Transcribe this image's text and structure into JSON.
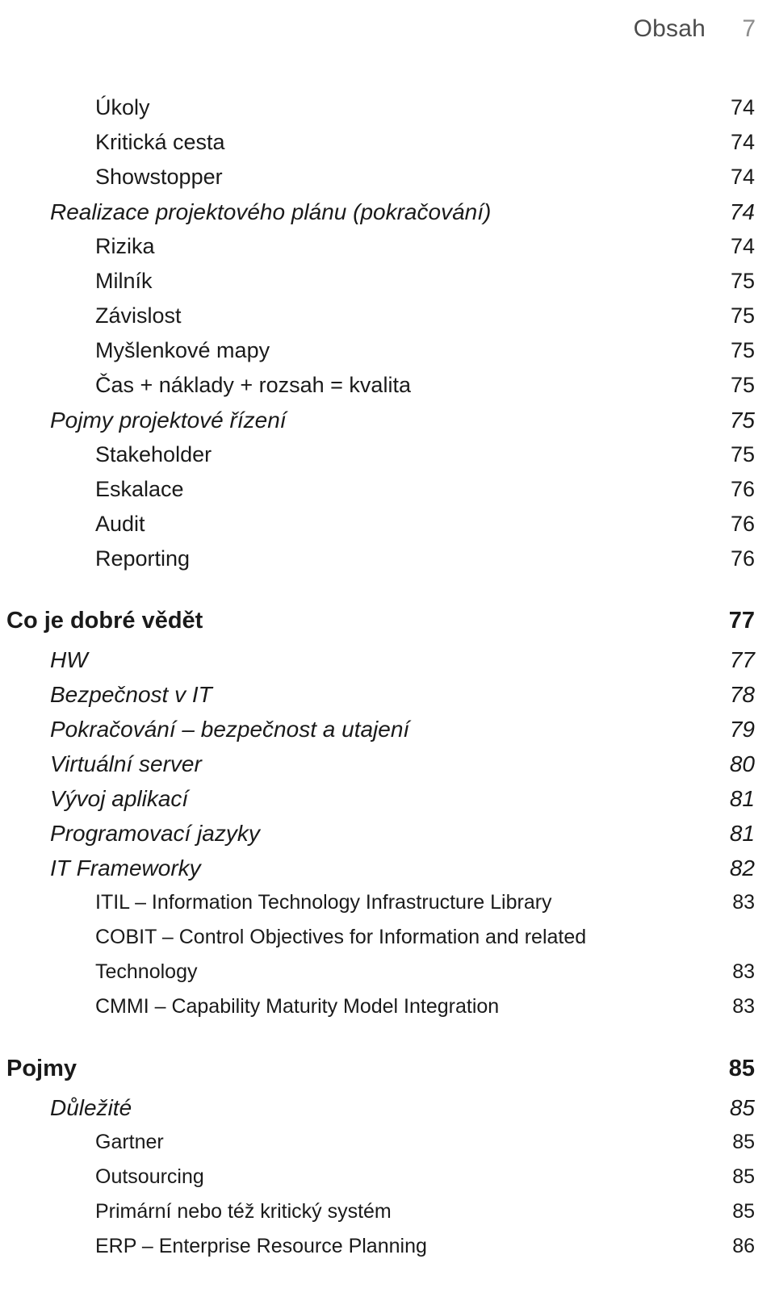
{
  "running_head": {
    "title": "Obsah",
    "folio": "7"
  },
  "toc": {
    "entries": [
      {
        "label": "Úkoly",
        "page": "74",
        "level": 2,
        "style": "plain"
      },
      {
        "label": "Kritická cesta",
        "page": "74",
        "level": 2,
        "style": "plain"
      },
      {
        "label": "Showstopper",
        "page": "74",
        "level": 2,
        "style": "plain"
      },
      {
        "label": "Realizace projektového plánu (pokračování)",
        "page": "74",
        "level": 1,
        "style": "italic"
      },
      {
        "label": "Rizika",
        "page": "74",
        "level": 2,
        "style": "plain"
      },
      {
        "label": "Milník",
        "page": "75",
        "level": 2,
        "style": "plain"
      },
      {
        "label": "Závislost",
        "page": "75",
        "level": 2,
        "style": "plain"
      },
      {
        "label": "Myšlenkové mapy",
        "page": "75",
        "level": 2,
        "style": "plain"
      },
      {
        "label": "Čas + náklady + rozsah = kvalita",
        "page": "75",
        "level": 2,
        "style": "plain"
      },
      {
        "label": "Pojmy projektové řízení",
        "page": "75",
        "level": 1,
        "style": "italic"
      },
      {
        "label": "Stakeholder",
        "page": "75",
        "level": 2,
        "style": "plain"
      },
      {
        "label": "Eskalace",
        "page": "76",
        "level": 2,
        "style": "plain"
      },
      {
        "label": "Audit",
        "page": "76",
        "level": 2,
        "style": "plain"
      },
      {
        "label": "Reporting",
        "page": "76",
        "level": 2,
        "style": "plain"
      },
      {
        "label": "Co je dobré vědět",
        "page": "77",
        "level": 0,
        "style": "bold"
      },
      {
        "label": "HW",
        "page": "77",
        "level": 1,
        "style": "italic"
      },
      {
        "label": "Bezpečnost v IT",
        "page": "78",
        "level": 1,
        "style": "italic"
      },
      {
        "label": "Pokračování – bezpečnost a utajení",
        "page": "79",
        "level": 1,
        "style": "italic"
      },
      {
        "label": "Virtuální server",
        "page": "80",
        "level": 1,
        "style": "italic"
      },
      {
        "label": "Vývoj aplikací",
        "page": "81",
        "level": 1,
        "style": "italic"
      },
      {
        "label": "Programovací jazyky",
        "page": "81",
        "level": 1,
        "style": "italic"
      },
      {
        "label": "IT Frameworky",
        "page": "82",
        "level": 1,
        "style": "italic"
      },
      {
        "label": "ITIL – Information Technology Infrastructure Library",
        "page": "83",
        "level": 3,
        "style": "plain"
      },
      {
        "label": "COBIT – Control Objectives for Information and related",
        "page": "",
        "level": 3,
        "style": "plain"
      },
      {
        "label": "Technology",
        "page": "83",
        "level": 3,
        "style": "plain"
      },
      {
        "label": "CMMI – Capability Maturity Model Integration",
        "page": "83",
        "level": 3,
        "style": "plain"
      },
      {
        "label": "Pojmy",
        "page": "85",
        "level": 0,
        "style": "bold"
      },
      {
        "label": "Důležité",
        "page": "85",
        "level": 1,
        "style": "italic"
      },
      {
        "label": "Gartner",
        "page": "85",
        "level": 3,
        "style": "plain"
      },
      {
        "label": "Outsourcing",
        "page": "85",
        "level": 3,
        "style": "plain"
      },
      {
        "label": "Primární nebo též kritický systém",
        "page": "85",
        "level": 3,
        "style": "plain"
      },
      {
        "label": "ERP – Enterprise Resource Planning",
        "page": "86",
        "level": 3,
        "style": "plain"
      }
    ]
  }
}
